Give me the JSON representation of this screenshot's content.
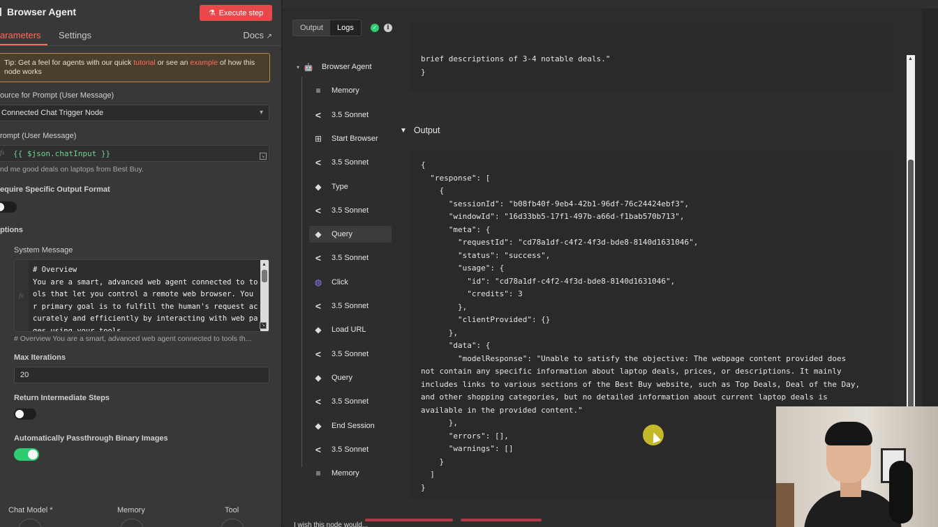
{
  "left": {
    "title": "Browser Agent",
    "execute_label": "Execute step",
    "tab_parameters": "arameters",
    "tab_settings": "Settings",
    "docs_label": "Docs",
    "tip_prefix": "Tip: Get a feel for agents with our quick ",
    "tip_link1": "tutorial",
    "tip_mid": " or see an ",
    "tip_link2": "example",
    "tip_suffix": " of how this node works",
    "source_label": "ource for Prompt (User Message)",
    "source_value": "Connected Chat Trigger Node",
    "prompt_label": "rompt (User Message)",
    "prompt_expr": "{{ $json.chatInput }}",
    "prompt_hint": "nd me good deals on laptops from Best Buy.",
    "req_format_label": "equire Specific Output Format",
    "options_label": "ptions",
    "system_message_label": "System Message",
    "system_message_text": "# Overview\nYou are a smart, advanced web agent connected to to\nols that let you control a remote web browser. You\nr primary goal is to fulfill the human's request ac\ncurately and efficiently by interacting with web pa\nges using your tools",
    "system_message_hint": "# Overview You are a smart, advanced web agent connected to tools th...",
    "max_iter_label": "Max Iterations",
    "max_iter_value": "20",
    "return_steps_label": "Return Intermediate Steps",
    "passthrough_label": "Automatically Passthrough Binary Images",
    "sub_chat_model": "Chat Model *",
    "sub_memory": "Memory",
    "sub_tool": "Tool",
    "toggles": {
      "require_format": false,
      "return_steps": false,
      "passthrough": true
    }
  },
  "right": {
    "tab_output": "Output",
    "tab_logs": "Logs",
    "tree": [
      {
        "label": "Browser Agent",
        "icon": "robot-icon",
        "root": true
      },
      {
        "label": "Memory",
        "icon": "database-icon"
      },
      {
        "label": "3.5 Sonnet",
        "icon": "anthropic-icon"
      },
      {
        "label": "Start Browser",
        "icon": "sitemap-icon"
      },
      {
        "label": "3.5 Sonnet",
        "icon": "anthropic-icon"
      },
      {
        "label": "Type",
        "icon": "browserbase-icon"
      },
      {
        "label": "3.5 Sonnet",
        "icon": "anthropic-icon"
      },
      {
        "label": "Query",
        "icon": "browserbase-icon",
        "selected": true
      },
      {
        "label": "3.5 Sonnet",
        "icon": "anthropic-icon"
      },
      {
        "label": "Click",
        "icon": "globe-icon"
      },
      {
        "label": "3.5 Sonnet",
        "icon": "anthropic-icon"
      },
      {
        "label": "Load URL",
        "icon": "browserbase-icon"
      },
      {
        "label": "3.5 Sonnet",
        "icon": "anthropic-icon"
      },
      {
        "label": "Query",
        "icon": "browserbase-icon"
      },
      {
        "label": "3.5 Sonnet",
        "icon": "anthropic-icon"
      },
      {
        "label": "End Session",
        "icon": "browserbase-icon"
      },
      {
        "label": "3.5 Sonnet",
        "icon": "anthropic-icon"
      },
      {
        "label": "Memory",
        "icon": "database-icon"
      }
    ],
    "prev_json": "brief descriptions of 3-4 notable deals.\"\n}",
    "output_heading": "Output",
    "output_json": "{\n  \"response\": [\n    {\n      \"sessionId\": \"b08fb40f-9eb4-42b1-96df-76c24424ebf3\",\n      \"windowId\": \"16d33bb5-17f1-497b-a66d-f1bab570b713\",\n      \"meta\": {\n        \"requestId\": \"cd78a1df-c4f2-4f3d-bde8-8140d1631046\",\n        \"status\": \"success\",\n        \"usage\": {\n          \"id\": \"cd78a1df-c4f2-4f3d-bde8-8140d1631046\",\n          \"credits\": 3\n        },\n        \"clientProvided\": {}\n      },\n      \"data\": {\n        \"modelResponse\": \"Unable to satisfy the objective: The webpage content provided does\nnot contain any specific information about laptop deals, prices, or descriptions. It mainly\nincludes links to various sections of the Best Buy website, such as Top Deals, Deal of the Day,\nand other shopping categories, but no detailed information about current laptop deals is\navailable in the provided content.\"\n      },\n      \"errors\": [],\n      \"warnings\": []\n    }\n  ]\n}",
    "bottom_text": "I wish this node would..."
  },
  "colors": {
    "accent": "#ff6d5a",
    "execute": "#e9484a",
    "success": "#2ecc71",
    "json_expr": "#6fd38c"
  }
}
